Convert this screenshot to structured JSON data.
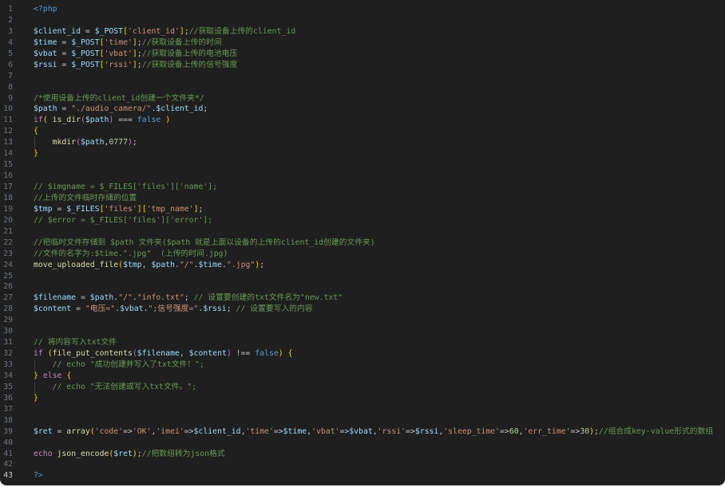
{
  "editor": {
    "active_line": 43,
    "lines": [
      {
        "n": "1",
        "tokens": [
          [
            "t-php",
            "<?php"
          ]
        ]
      },
      {
        "n": "2",
        "tokens": []
      },
      {
        "n": "3",
        "tokens": [
          [
            "t-var",
            "$client_id"
          ],
          [
            "t-pun",
            " = "
          ],
          [
            "t-var",
            "$_POST"
          ],
          [
            "t-br1",
            "["
          ],
          [
            "t-str",
            "'client_id'"
          ],
          [
            "t-br1",
            "]"
          ],
          [
            "t-pun",
            ";"
          ],
          [
            "t-cmt",
            "//获取设备上传的client_id"
          ]
        ]
      },
      {
        "n": "4",
        "tokens": [
          [
            "t-var",
            "$time"
          ],
          [
            "t-pun",
            " = "
          ],
          [
            "t-var",
            "$_POST"
          ],
          [
            "t-br1",
            "["
          ],
          [
            "t-str",
            "'time'"
          ],
          [
            "t-br1",
            "]"
          ],
          [
            "t-pun",
            ";"
          ],
          [
            "t-cmt",
            "//获取设备上传的时间"
          ]
        ]
      },
      {
        "n": "5",
        "tokens": [
          [
            "t-var",
            "$vbat"
          ],
          [
            "t-pun",
            " = "
          ],
          [
            "t-var",
            "$_POST"
          ],
          [
            "t-br1",
            "["
          ],
          [
            "t-str",
            "'vbat'"
          ],
          [
            "t-br1",
            "]"
          ],
          [
            "t-pun",
            ";"
          ],
          [
            "t-cmt",
            "//获取设备上传的电池电压"
          ]
        ]
      },
      {
        "n": "6",
        "tokens": [
          [
            "t-var",
            "$rssi"
          ],
          [
            "t-pun",
            " = "
          ],
          [
            "t-var",
            "$_POST"
          ],
          [
            "t-br1",
            "["
          ],
          [
            "t-str",
            "'rssi'"
          ],
          [
            "t-br1",
            "]"
          ],
          [
            "t-pun",
            ";"
          ],
          [
            "t-cmt",
            "//获取设备上传的信号强度"
          ]
        ]
      },
      {
        "n": "7",
        "tokens": []
      },
      {
        "n": "8",
        "tokens": []
      },
      {
        "n": "9",
        "tokens": [
          [
            "t-cmt",
            "/*使用设备上传的client_id创建一个文件夹*/"
          ]
        ]
      },
      {
        "n": "10",
        "tokens": [
          [
            "t-var",
            "$path"
          ],
          [
            "t-pun",
            " = "
          ],
          [
            "t-str",
            "\"./audio_camera/\""
          ],
          [
            "t-pun",
            "."
          ],
          [
            "t-var",
            "$client_id"
          ],
          [
            "t-pun",
            ";"
          ]
        ]
      },
      {
        "n": "11",
        "tokens": [
          [
            "t-kw",
            "if"
          ],
          [
            "t-br1",
            "("
          ],
          [
            "t-pun",
            " "
          ],
          [
            "t-fn",
            "is_dir"
          ],
          [
            "t-br2",
            "("
          ],
          [
            "t-var",
            "$path"
          ],
          [
            "t-br2",
            ")"
          ],
          [
            "t-pun",
            " === "
          ],
          [
            "t-const",
            "false"
          ],
          [
            "t-pun",
            " "
          ],
          [
            "t-br1",
            ")"
          ]
        ]
      },
      {
        "n": "12",
        "tokens": [
          [
            "t-br1",
            "{"
          ]
        ]
      },
      {
        "n": "13",
        "guide": true,
        "tokens": [
          [
            "t-pun",
            "    "
          ],
          [
            "t-fn",
            "mkdir"
          ],
          [
            "t-br2",
            "("
          ],
          [
            "t-var",
            "$path"
          ],
          [
            "t-pun",
            ","
          ],
          [
            "t-num",
            "0777"
          ],
          [
            "t-br2",
            ")"
          ],
          [
            "t-pun",
            ";"
          ]
        ]
      },
      {
        "n": "14",
        "tokens": [
          [
            "t-br1",
            "}"
          ]
        ]
      },
      {
        "n": "15",
        "tokens": []
      },
      {
        "n": "16",
        "tokens": []
      },
      {
        "n": "17",
        "tokens": [
          [
            "t-cmt",
            "// $imgname = $_FILES['files']['name'];"
          ]
        ]
      },
      {
        "n": "18",
        "tokens": [
          [
            "t-cmt",
            "//上传的文件临时存储的位置"
          ]
        ]
      },
      {
        "n": "19",
        "tokens": [
          [
            "t-var",
            "$tmp"
          ],
          [
            "t-pun",
            " = "
          ],
          [
            "t-var",
            "$_FILES"
          ],
          [
            "t-br1",
            "["
          ],
          [
            "t-str",
            "'files'"
          ],
          [
            "t-br1",
            "]"
          ],
          [
            "t-br1",
            "["
          ],
          [
            "t-str",
            "'tmp_name'"
          ],
          [
            "t-br1",
            "]"
          ],
          [
            "t-pun",
            ";"
          ]
        ]
      },
      {
        "n": "20",
        "tokens": [
          [
            "t-cmt",
            "// $error = $_FILES['files']['error'];"
          ]
        ]
      },
      {
        "n": "21",
        "tokens": []
      },
      {
        "n": "22",
        "tokens": [
          [
            "t-cmt",
            "//把临时文件存储到 $path 文件夹($path 就是上面以设备的上传的client_id创建的文件夹)"
          ]
        ]
      },
      {
        "n": "23",
        "tokens": [
          [
            "t-cmt",
            "//文件的名字为:$time.\".jpg\"  (上传的时间.jpg)"
          ]
        ]
      },
      {
        "n": "24",
        "tokens": [
          [
            "t-fn",
            "move_uploaded_file"
          ],
          [
            "t-br1",
            "("
          ],
          [
            "t-var",
            "$tmp"
          ],
          [
            "t-pun",
            ", "
          ],
          [
            "t-var",
            "$path"
          ],
          [
            "t-pun",
            "."
          ],
          [
            "t-str",
            "\"/\""
          ],
          [
            "t-pun",
            "."
          ],
          [
            "t-var",
            "$time"
          ],
          [
            "t-pun",
            "."
          ],
          [
            "t-str",
            "\".jpg\""
          ],
          [
            "t-br1",
            ")"
          ],
          [
            "t-pun",
            ";"
          ]
        ]
      },
      {
        "n": "25",
        "tokens": []
      },
      {
        "n": "26",
        "tokens": []
      },
      {
        "n": "27",
        "tokens": [
          [
            "t-var",
            "$filename"
          ],
          [
            "t-pun",
            " = "
          ],
          [
            "t-var",
            "$path"
          ],
          [
            "t-pun",
            "."
          ],
          [
            "t-str",
            "\"/\""
          ],
          [
            "t-pun",
            "."
          ],
          [
            "t-str",
            "\"info.txt\""
          ],
          [
            "t-pun",
            "; "
          ],
          [
            "t-cmt",
            "// 设置要创建的txt文件名为\"new.txt\""
          ]
        ]
      },
      {
        "n": "28",
        "tokens": [
          [
            "t-var",
            "$content"
          ],
          [
            "t-pun",
            " = "
          ],
          [
            "t-str",
            "\"电压=\""
          ],
          [
            "t-pun",
            "."
          ],
          [
            "t-var",
            "$vbat"
          ],
          [
            "t-pun",
            "."
          ],
          [
            "t-str",
            "\";信号强度=\""
          ],
          [
            "t-pun",
            "."
          ],
          [
            "t-var",
            "$rssi"
          ],
          [
            "t-pun",
            "; "
          ],
          [
            "t-cmt",
            "// 设置要写入的内容"
          ]
        ]
      },
      {
        "n": "29",
        "tokens": []
      },
      {
        "n": "30",
        "tokens": []
      },
      {
        "n": "31",
        "tokens": [
          [
            "t-cmt",
            "// 将内容写入txt文件"
          ]
        ]
      },
      {
        "n": "32",
        "tokens": [
          [
            "t-kw",
            "if"
          ],
          [
            "t-pun",
            " "
          ],
          [
            "t-br1",
            "("
          ],
          [
            "t-fn",
            "file_put_contents"
          ],
          [
            "t-br2",
            "("
          ],
          [
            "t-var",
            "$filename"
          ],
          [
            "t-pun",
            ", "
          ],
          [
            "t-var",
            "$content"
          ],
          [
            "t-br2",
            ")"
          ],
          [
            "t-pun",
            " !== "
          ],
          [
            "t-const",
            "false"
          ],
          [
            "t-br1",
            ")"
          ],
          [
            "t-pun",
            " "
          ],
          [
            "t-br1",
            "{"
          ]
        ]
      },
      {
        "n": "33",
        "guide": true,
        "tokens": [
          [
            "t-pun",
            "    "
          ],
          [
            "t-cmt",
            "// echo \"成功创建并写入了txt文件！\";"
          ]
        ]
      },
      {
        "n": "34",
        "tokens": [
          [
            "t-br1",
            "}"
          ],
          [
            "t-pun",
            " "
          ],
          [
            "t-kw",
            "else"
          ],
          [
            "t-pun",
            " "
          ],
          [
            "t-br1",
            "{"
          ]
        ]
      },
      {
        "n": "35",
        "guide": true,
        "tokens": [
          [
            "t-pun",
            "    "
          ],
          [
            "t-cmt",
            "// echo \"无法创建或写入txt文件。\";"
          ]
        ]
      },
      {
        "n": "36",
        "tokens": [
          [
            "t-br1",
            "}"
          ]
        ]
      },
      {
        "n": "37",
        "tokens": []
      },
      {
        "n": "38",
        "tokens": []
      },
      {
        "n": "39",
        "tokens": [
          [
            "t-var",
            "$ret"
          ],
          [
            "t-pun",
            " = "
          ],
          [
            "t-fn",
            "array"
          ],
          [
            "t-br1",
            "("
          ],
          [
            "t-str",
            "'code'"
          ],
          [
            "t-pun",
            "=>"
          ],
          [
            "t-str",
            "'OK'"
          ],
          [
            "t-pun",
            ","
          ],
          [
            "t-str",
            "'imei'"
          ],
          [
            "t-pun",
            "=>"
          ],
          [
            "t-var",
            "$client_id"
          ],
          [
            "t-pun",
            ","
          ],
          [
            "t-str",
            "'time'"
          ],
          [
            "t-pun",
            "=>"
          ],
          [
            "t-var",
            "$time"
          ],
          [
            "t-pun",
            ","
          ],
          [
            "t-str",
            "'vbat'"
          ],
          [
            "t-pun",
            "=>"
          ],
          [
            "t-var",
            "$vbat"
          ],
          [
            "t-pun",
            ","
          ],
          [
            "t-str",
            "'rssi'"
          ],
          [
            "t-pun",
            "=>"
          ],
          [
            "t-var",
            "$rssi"
          ],
          [
            "t-pun",
            ","
          ],
          [
            "t-str",
            "'sleep_time'"
          ],
          [
            "t-pun",
            "=>"
          ],
          [
            "t-num",
            "60"
          ],
          [
            "t-pun",
            ","
          ],
          [
            "t-str",
            "'err_time'"
          ],
          [
            "t-pun",
            "=>"
          ],
          [
            "t-num",
            "30"
          ],
          [
            "t-br1",
            ")"
          ],
          [
            "t-pun",
            ";"
          ],
          [
            "t-cmt",
            "//组合成key-value形式的数组"
          ]
        ]
      },
      {
        "n": "40",
        "tokens": []
      },
      {
        "n": "41",
        "tokens": [
          [
            "t-kw",
            "echo"
          ],
          [
            "t-pun",
            " "
          ],
          [
            "t-fn",
            "json_encode"
          ],
          [
            "t-br1",
            "("
          ],
          [
            "t-var",
            "$ret"
          ],
          [
            "t-br1",
            ")"
          ],
          [
            "t-pun",
            ";"
          ],
          [
            "t-cmt",
            "//把数组转为json格式"
          ]
        ]
      },
      {
        "n": "42",
        "tokens": []
      },
      {
        "n": "43",
        "tokens": [
          [
            "t-php",
            "?>"
          ]
        ]
      }
    ]
  }
}
